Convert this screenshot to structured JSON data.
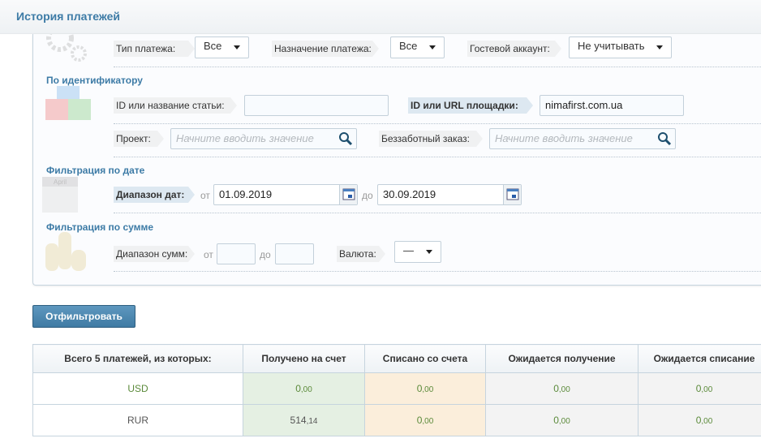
{
  "header": {
    "title": "История платежей"
  },
  "filters": {
    "payment_type": {
      "label": "Тип платежа:",
      "value": "Все"
    },
    "payment_purpose": {
      "label": "Назначение платежа:",
      "value": "Все"
    },
    "guest_account": {
      "label": "Гостевой аккаунт:",
      "value": "Не учитывать"
    },
    "by_id": {
      "title": "По идентификатору",
      "article": {
        "label": "ID или название статьи:",
        "value": ""
      },
      "site": {
        "label": "ID или URL площадки:",
        "value": "nimafirst.com.ua"
      },
      "project": {
        "label": "Проект:",
        "placeholder": "Начните вводить значение"
      },
      "carefree": {
        "label": "Беззаботный заказ:",
        "placeholder": "Начните вводить значение"
      }
    },
    "by_date": {
      "title": "Фильтрация по дате",
      "label": "Диапазон дат:",
      "from_label": "от",
      "from": "01.09.2019",
      "to_label": "до",
      "to": "30.09.2019",
      "icon_text": "April"
    },
    "by_sum": {
      "title": "Фильтрация по сумме",
      "label": "Диапазон сумм:",
      "from_label": "от",
      "from": "",
      "to_label": "до",
      "to": "",
      "currency_label": "Валюта:",
      "currency": "—"
    }
  },
  "filter_button": "Отфильтровать",
  "summary": {
    "headers": [
      "Всего 5 платежей, из которых:",
      "Получено на счет",
      "Списано со счета",
      "Ожидается получение",
      "Ожидается списание"
    ],
    "rows": [
      {
        "currency": "USD",
        "values": [
          [
            "0",
            ",00"
          ],
          [
            "0",
            ",00"
          ],
          [
            "0",
            ",00"
          ],
          [
            "0",
            ",00"
          ]
        ]
      },
      {
        "currency": "RUR",
        "values": [
          [
            "514",
            ",14"
          ],
          [
            "0",
            ",00"
          ],
          [
            "0",
            ",00"
          ],
          [
            "0",
            ",00"
          ]
        ]
      }
    ]
  },
  "colors": {
    "accent": "#3d7ba6",
    "received": "#e5f0e3",
    "debited": "#fbeedb",
    "pending": "#f3f3f3"
  }
}
